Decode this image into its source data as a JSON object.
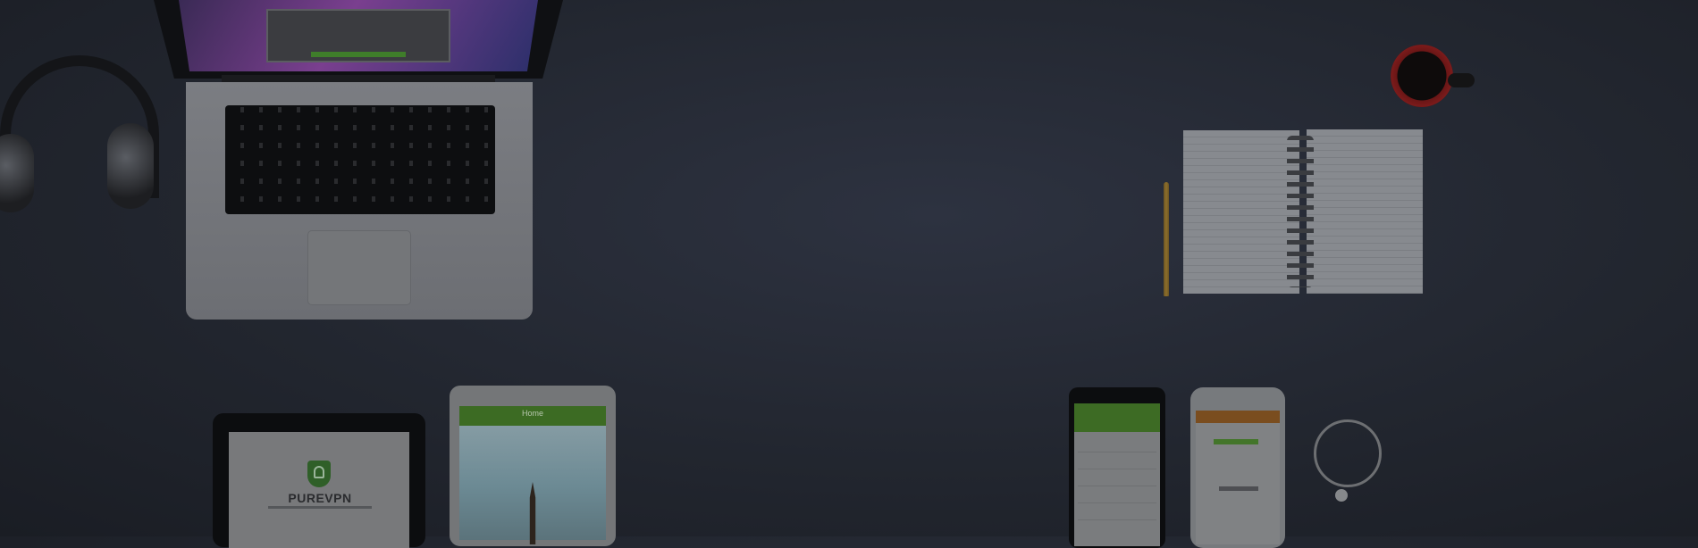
{
  "scene": {
    "background_color": "#22262f",
    "tablet_app": {
      "brand": "PUREVPN"
    },
    "ipad_app": {
      "title": "Home"
    }
  }
}
